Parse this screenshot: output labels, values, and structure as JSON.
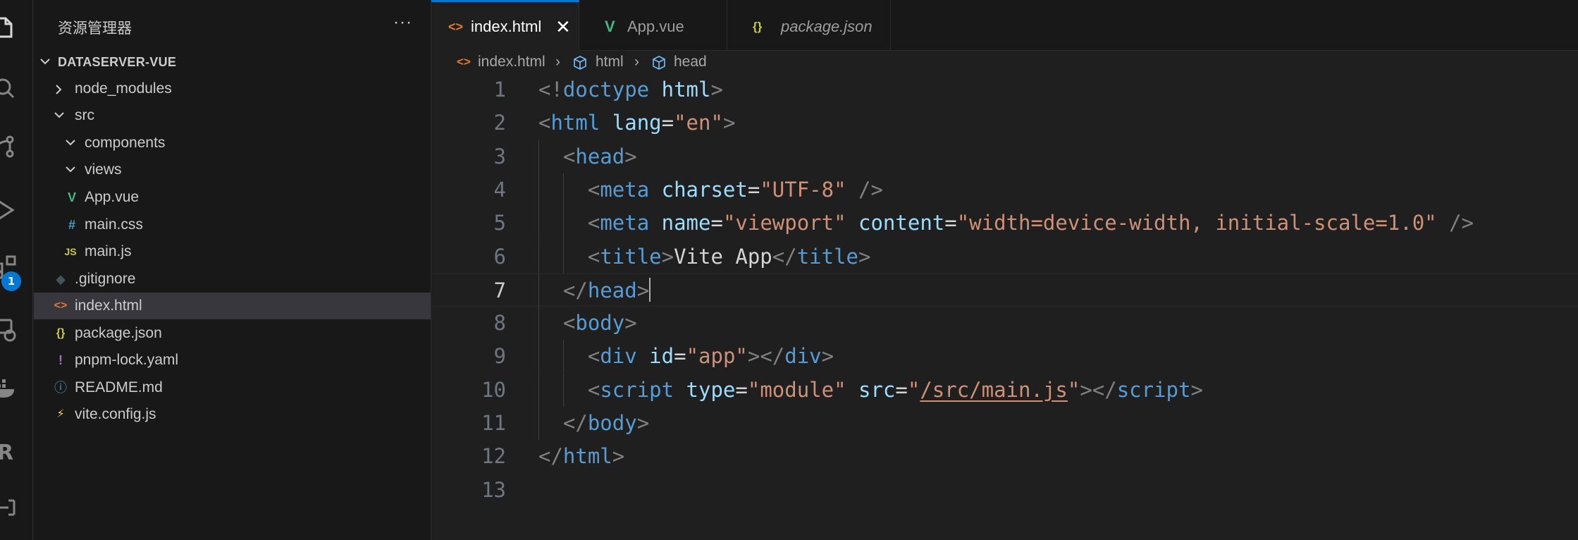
{
  "sidebar": {
    "title": "资源管理器",
    "more": "···",
    "root": "DATASERVER-VUE",
    "items": [
      {
        "label": "node_modules",
        "icon": ""
      },
      {
        "label": "src",
        "icon": ""
      },
      {
        "label": "components",
        "icon": ""
      },
      {
        "label": "views",
        "icon": ""
      },
      {
        "label": "App.vue",
        "icon": "V"
      },
      {
        "label": "main.css",
        "icon": "#"
      },
      {
        "label": "main.js",
        "icon": "JS"
      },
      {
        "label": ".gitignore",
        "icon": "◆"
      },
      {
        "label": "index.html",
        "icon": "<>"
      },
      {
        "label": "package.json",
        "icon": "{}"
      },
      {
        "label": "pnpm-lock.yaml",
        "icon": "!"
      },
      {
        "label": "README.md",
        "icon": "ⓘ"
      },
      {
        "label": "vite.config.js",
        "icon": "⚡"
      }
    ]
  },
  "activity_bar": {
    "extensions_badge": "1"
  },
  "tabs": [
    {
      "label": "index.html",
      "icon": "<>",
      "close": "✕"
    },
    {
      "label": "App.vue",
      "icon": "V"
    },
    {
      "label": "package.json",
      "icon": "{}"
    }
  ],
  "breadcrumb": {
    "file": "index.html",
    "sep": "›",
    "items": [
      "html",
      "head"
    ]
  },
  "editor": {
    "line_numbers": [
      "1",
      "2",
      "3",
      "4",
      "5",
      "6",
      "7",
      "8",
      "9",
      "10",
      "11",
      "12",
      "13"
    ],
    "lines": [
      [
        [
          "t-punct",
          "<!"
        ],
        [
          "t-tag",
          "doctype"
        ],
        [
          "t-text",
          " "
        ],
        [
          "t-attr",
          "html"
        ],
        [
          "t-punct",
          ">"
        ]
      ],
      [
        [
          "t-punct",
          "<"
        ],
        [
          "t-tag",
          "html"
        ],
        [
          "t-text",
          " "
        ],
        [
          "t-attr",
          "lang"
        ],
        [
          "t-text",
          "="
        ],
        [
          "t-str",
          "\"en\""
        ],
        [
          "t-punct",
          ">"
        ]
      ],
      [
        [
          "t-text",
          "  "
        ],
        [
          "t-punct",
          "<"
        ],
        [
          "t-tag",
          "head"
        ],
        [
          "t-punct",
          ">"
        ]
      ],
      [
        [
          "t-text",
          "    "
        ],
        [
          "t-punct",
          "<"
        ],
        [
          "t-tag",
          "meta"
        ],
        [
          "t-text",
          " "
        ],
        [
          "t-attr",
          "charset"
        ],
        [
          "t-text",
          "="
        ],
        [
          "t-str",
          "\"UTF-8\""
        ],
        [
          "t-text",
          " "
        ],
        [
          "t-punct",
          "/>"
        ]
      ],
      [
        [
          "t-text",
          "    "
        ],
        [
          "t-punct",
          "<"
        ],
        [
          "t-tag",
          "meta"
        ],
        [
          "t-text",
          " "
        ],
        [
          "t-attr",
          "name"
        ],
        [
          "t-text",
          "="
        ],
        [
          "t-str",
          "\"viewport\""
        ],
        [
          "t-text",
          " "
        ],
        [
          "t-attr",
          "content"
        ],
        [
          "t-text",
          "="
        ],
        [
          "t-str",
          "\"width=device-width, initial-scale=1.0\""
        ],
        [
          "t-text",
          " "
        ],
        [
          "t-punct",
          "/>"
        ]
      ],
      [
        [
          "t-text",
          "    "
        ],
        [
          "t-punct",
          "<"
        ],
        [
          "t-tag",
          "title"
        ],
        [
          "t-punct",
          ">"
        ],
        [
          "t-text",
          "Vite App"
        ],
        [
          "t-punct",
          "</"
        ],
        [
          "t-tag",
          "title"
        ],
        [
          "t-punct",
          ">"
        ]
      ],
      [
        [
          "t-text",
          "  "
        ],
        [
          "t-punct",
          "</"
        ],
        [
          "t-tag",
          "head"
        ],
        [
          "t-punct",
          ">"
        ]
      ],
      [
        [
          "t-text",
          "  "
        ],
        [
          "t-punct",
          "<"
        ],
        [
          "t-tag",
          "body"
        ],
        [
          "t-punct",
          ">"
        ]
      ],
      [
        [
          "t-text",
          "    "
        ],
        [
          "t-punct",
          "<"
        ],
        [
          "t-tag",
          "div"
        ],
        [
          "t-text",
          " "
        ],
        [
          "t-attr",
          "id"
        ],
        [
          "t-text",
          "="
        ],
        [
          "t-str",
          "\"app\""
        ],
        [
          "t-punct",
          "></"
        ],
        [
          "t-tag",
          "div"
        ],
        [
          "t-punct",
          ">"
        ]
      ],
      [
        [
          "t-text",
          "    "
        ],
        [
          "t-punct",
          "<"
        ],
        [
          "t-tag",
          "script"
        ],
        [
          "t-text",
          " "
        ],
        [
          "t-attr",
          "type"
        ],
        [
          "t-text",
          "="
        ],
        [
          "t-str",
          "\"module\""
        ],
        [
          "t-text",
          " "
        ],
        [
          "t-attr",
          "src"
        ],
        [
          "t-text",
          "="
        ],
        [
          "t-str",
          "\""
        ],
        [
          "t-link",
          "/src/main.js"
        ],
        [
          "t-str",
          "\""
        ],
        [
          "t-punct",
          "></"
        ],
        [
          "t-tag",
          "script"
        ],
        [
          "t-punct",
          ">"
        ]
      ],
      [
        [
          "t-text",
          "  "
        ],
        [
          "t-punct",
          "</"
        ],
        [
          "t-tag",
          "body"
        ],
        [
          "t-punct",
          ">"
        ]
      ],
      [
        [
          "t-punct",
          "</"
        ],
        [
          "t-tag",
          "html"
        ],
        [
          "t-punct",
          ">"
        ]
      ],
      []
    ],
    "current_line": 7
  },
  "colors": {
    "accent": "#0078d4",
    "vue": "#41b883",
    "html_icon": "#e37933",
    "json_icon": "#cbcb41",
    "css_icon": "#519aba",
    "js_icon": "#cbcb41",
    "git_icon": "#41535b",
    "yaml_icon": "#a074c4",
    "info_icon": "#519aba",
    "vite_icon": "#ffd62e"
  }
}
